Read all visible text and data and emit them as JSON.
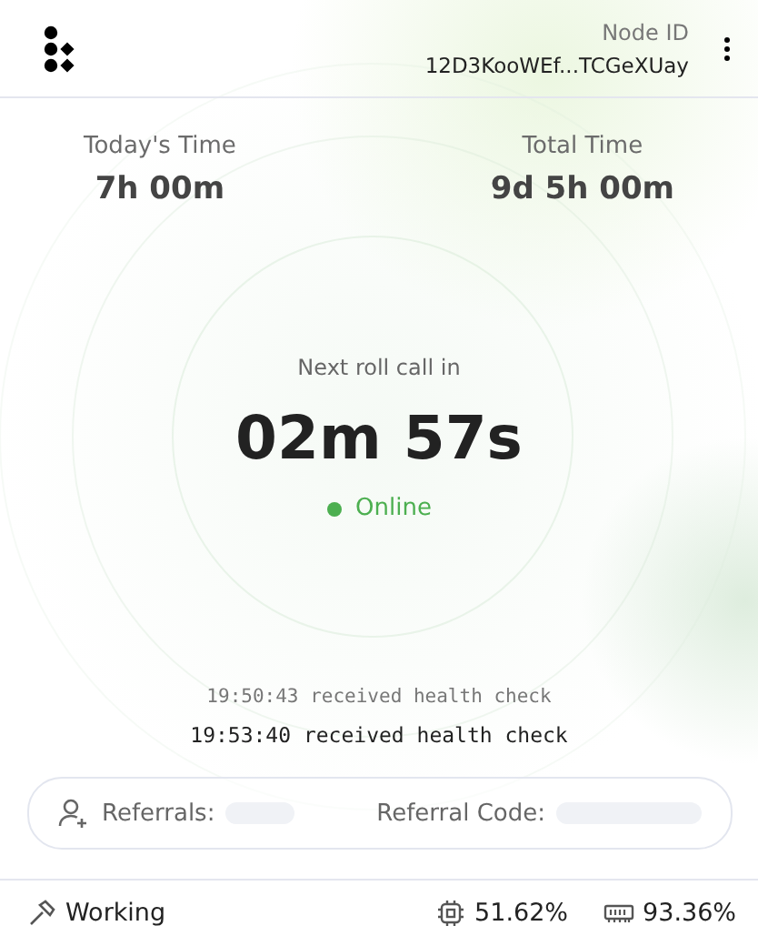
{
  "header": {
    "node_id_label": "Node ID",
    "node_id": "12D3KooWEf...TCGeXUay"
  },
  "stats": [
    {
      "label": "Today's Time",
      "value": "7h 00m"
    },
    {
      "label": "Total Time",
      "value": "9d 5h 00m"
    }
  ],
  "countdown": {
    "label": "Next roll call in",
    "minutes": "02m",
    "seconds": "57s"
  },
  "status": {
    "label": "Online",
    "color": "#4caf50"
  },
  "log": [
    {
      "text": "19:50:43 received health check",
      "latest": false
    },
    {
      "text": "19:53:40 received health check",
      "latest": true
    }
  ],
  "referral": {
    "referrals_label": "Referrals:",
    "code_label": "Referral Code:"
  },
  "footer": {
    "state": "Working",
    "cpu": "51.62%",
    "memory": "93.36%"
  }
}
